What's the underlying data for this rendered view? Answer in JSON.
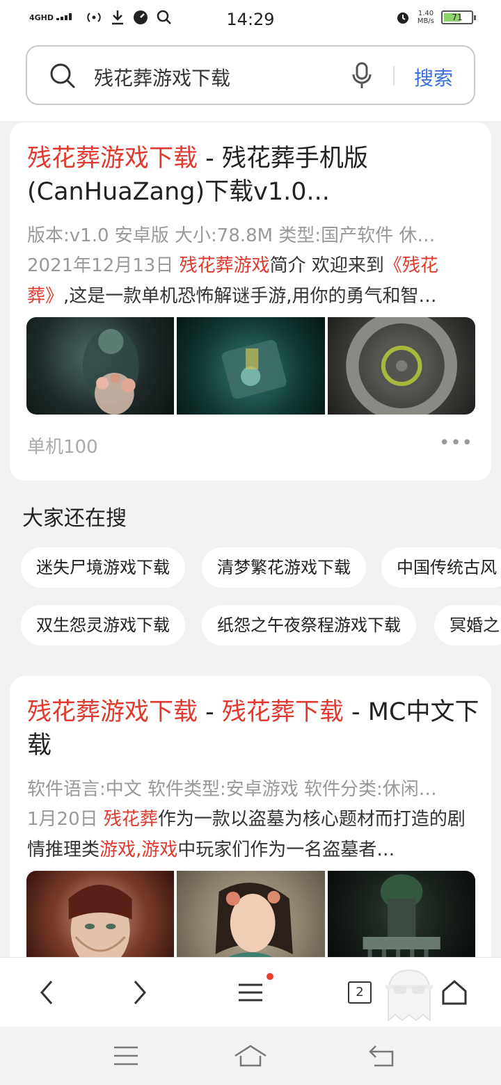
{
  "status_bar": {
    "network": "4GHD",
    "time": "14:29",
    "speed_value": "1.40",
    "speed_unit": "MB/s",
    "battery": "71"
  },
  "search": {
    "query": "残花葬游戏下载",
    "submit_label": "搜索"
  },
  "results": [
    {
      "title_highlight": "残花葬游戏下载",
      "title_rest": " - 残花葬手机版(CanHuaZang)下载v1.0...",
      "meta": "版本:v1.0 安卓版  大小:78.8M  类型:国产软件  休…",
      "date": "2021年12月13日",
      "snippet_parts": [
        {
          "text": "残花葬游戏",
          "hl": true
        },
        {
          "text": "简介 欢迎来到",
          "hl": false
        },
        {
          "text": "《残花葬》",
          "hl": true
        },
        {
          "text": ",这是一款单机恐怖解谜手游,用你的勇气和智…",
          "hl": false
        }
      ],
      "source": "单机100",
      "more": "•••"
    },
    {
      "title_parts": [
        {
          "text": "残花葬游戏下载",
          "hl": true
        },
        {
          "text": " - ",
          "hl": false
        },
        {
          "text": "残花葬下载",
          "hl": true
        },
        {
          "text": " - MC中文下载",
          "hl": false
        }
      ],
      "meta": "软件语言:中文  软件类型:安卓游戏  软件分类:休闲…",
      "date": "1月20日",
      "snippet_parts": [
        {
          "text": "残花葬",
          "hl": true
        },
        {
          "text": "作为一款以盗墓为核心题材而打造的剧情推理类",
          "hl": false
        },
        {
          "text": "游戏,游戏",
          "hl": true
        },
        {
          "text": "中玩家们作为一名盗墓者…",
          "hl": false
        }
      ]
    }
  ],
  "related": {
    "title": "大家还在搜",
    "row1": [
      "迷失尸境游戏下载",
      "清梦繁花游戏下载",
      "中国传统古风"
    ],
    "row2": [
      "双生怨灵游戏下载",
      "纸怨之午夜祭程游戏下载",
      "冥婚之"
    ]
  },
  "bottom_nav": {
    "tabs_count": "2"
  },
  "colors": {
    "highlight": "#e03a2f",
    "accent": "#3a6fe0"
  }
}
